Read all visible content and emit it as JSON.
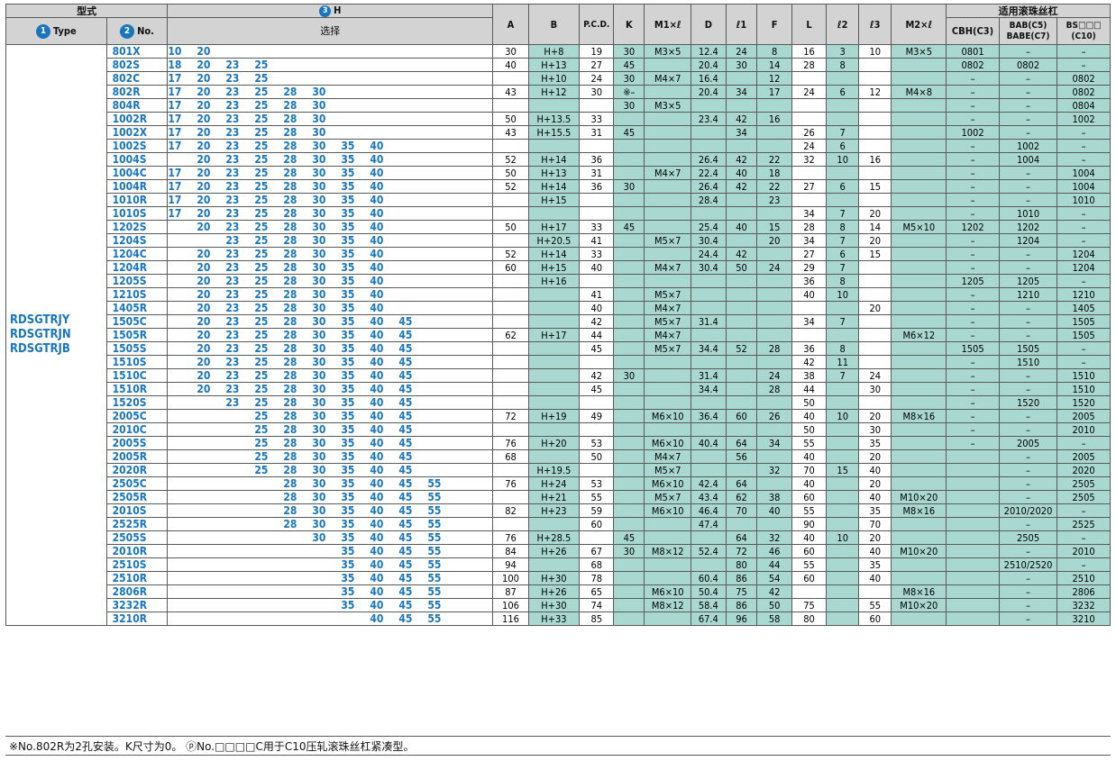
{
  "header": {
    "type_group": "型式",
    "type_label": "Type",
    "no_label": "No.",
    "h_label": "H",
    "h_sub": "选择",
    "badge1": "1",
    "badge2": "2",
    "badge3": "3",
    "cols": [
      "A",
      "B",
      "P.C.D.",
      "K",
      "M1×ℓ",
      "D",
      "ℓ1",
      "F",
      "L",
      "ℓ2",
      "ℓ3",
      "M2×ℓ"
    ],
    "screw_group": "适用滚珠丝杠",
    "cbh": "CBH(C3)",
    "bab": "BAB(C5) BABE(C7)",
    "bs": "BS□□□ (C10)"
  },
  "types": [
    "RDSGTRJY",
    "RDSGTRJN",
    "RDSGTRJB"
  ],
  "rows": [
    {
      "no": "801X",
      "h": [
        "10",
        "20",
        "",
        "",
        "",
        "",
        "",
        "",
        ""
      ]
    },
    {
      "no": "802S",
      "h": [
        "18",
        "20",
        "23",
        "25",
        "",
        "",
        "",
        "",
        ""
      ]
    },
    {
      "no": "802C",
      "h": [
        "17",
        "20",
        "23",
        "25",
        "",
        "",
        "",
        "",
        ""
      ]
    },
    {
      "no": "802R",
      "h": [
        "17",
        "20",
        "23",
        "25",
        "28",
        "30",
        "",
        "",
        ""
      ]
    },
    {
      "no": "804R",
      "h": [
        "17",
        "20",
        "23",
        "25",
        "28",
        "30",
        "",
        "",
        ""
      ]
    },
    {
      "no": "1002R",
      "h": [
        "17",
        "20",
        "23",
        "25",
        "28",
        "30",
        "",
        "",
        ""
      ]
    },
    {
      "no": "1002X",
      "h": [
        "17",
        "20",
        "23",
        "25",
        "28",
        "30",
        "",
        "",
        ""
      ]
    },
    {
      "no": "1002S",
      "h": [
        "17",
        "20",
        "23",
        "25",
        "28",
        "30",
        "35",
        "40",
        ""
      ]
    },
    {
      "no": "1004S",
      "h": [
        "",
        "20",
        "23",
        "25",
        "28",
        "30",
        "35",
        "40",
        ""
      ]
    },
    {
      "no": "1004C",
      "h": [
        "17",
        "20",
        "23",
        "25",
        "28",
        "30",
        "35",
        "40",
        ""
      ]
    },
    {
      "no": "1004R",
      "h": [
        "17",
        "20",
        "23",
        "25",
        "28",
        "30",
        "35",
        "40",
        ""
      ]
    },
    {
      "no": "1010R",
      "h": [
        "17",
        "20",
        "23",
        "25",
        "28",
        "30",
        "35",
        "40",
        ""
      ]
    },
    {
      "no": "1010S",
      "h": [
        "17",
        "20",
        "23",
        "25",
        "28",
        "30",
        "35",
        "40",
        ""
      ]
    },
    {
      "no": "1202S",
      "h": [
        "",
        "20",
        "23",
        "25",
        "28",
        "30",
        "35",
        "40",
        ""
      ]
    },
    {
      "no": "1204S",
      "h": [
        "",
        "",
        "23",
        "25",
        "28",
        "30",
        "35",
        "40",
        ""
      ]
    },
    {
      "no": "1204C",
      "h": [
        "",
        "20",
        "23",
        "25",
        "28",
        "30",
        "35",
        "40",
        ""
      ]
    },
    {
      "no": "1204R",
      "h": [
        "",
        "20",
        "23",
        "25",
        "28",
        "30",
        "35",
        "40",
        ""
      ]
    },
    {
      "no": "1205S",
      "h": [
        "",
        "20",
        "23",
        "25",
        "28",
        "30",
        "35",
        "40",
        ""
      ]
    },
    {
      "no": "1210S",
      "h": [
        "",
        "20",
        "23",
        "25",
        "28",
        "30",
        "35",
        "40",
        ""
      ]
    },
    {
      "no": "1405R",
      "h": [
        "",
        "20",
        "23",
        "25",
        "28",
        "30",
        "35",
        "40",
        ""
      ]
    },
    {
      "no": "1505C",
      "h": [
        "",
        "20",
        "23",
        "25",
        "28",
        "30",
        "35",
        "40",
        "45"
      ]
    },
    {
      "no": "1505R",
      "h": [
        "",
        "20",
        "23",
        "25",
        "28",
        "30",
        "35",
        "40",
        "45"
      ]
    },
    {
      "no": "1505S",
      "h": [
        "",
        "20",
        "23",
        "25",
        "28",
        "30",
        "35",
        "40",
        "45"
      ]
    },
    {
      "no": "1510S",
      "h": [
        "",
        "20",
        "23",
        "25",
        "28",
        "30",
        "35",
        "40",
        "45"
      ]
    },
    {
      "no": "1510C",
      "h": [
        "",
        "20",
        "23",
        "25",
        "28",
        "30",
        "35",
        "40",
        "45"
      ]
    },
    {
      "no": "1510R",
      "h": [
        "",
        "20",
        "23",
        "25",
        "28",
        "30",
        "35",
        "40",
        "45"
      ]
    },
    {
      "no": "1520S",
      "h": [
        "",
        "",
        "23",
        "25",
        "28",
        "30",
        "35",
        "40",
        "45"
      ]
    },
    {
      "no": "2005C",
      "h": [
        "",
        "",
        "",
        "25",
        "28",
        "30",
        "35",
        "40",
        "45"
      ]
    },
    {
      "no": "2010C",
      "h": [
        "",
        "",
        "",
        "25",
        "28",
        "30",
        "35",
        "40",
        "45"
      ]
    },
    {
      "no": "2005S",
      "h": [
        "",
        "",
        "",
        "25",
        "28",
        "30",
        "35",
        "40",
        "45"
      ]
    },
    {
      "no": "2005R",
      "h": [
        "",
        "",
        "",
        "25",
        "28",
        "30",
        "35",
        "40",
        "45"
      ]
    },
    {
      "no": "2020R",
      "h": [
        "",
        "",
        "",
        "25",
        "28",
        "30",
        "35",
        "40",
        "45"
      ]
    },
    {
      "no": "2505C",
      "h": [
        "",
        "",
        "",
        "",
        "28",
        "30",
        "35",
        "40",
        "45",
        "55"
      ]
    },
    {
      "no": "2505R",
      "h": [
        "",
        "",
        "",
        "",
        "28",
        "30",
        "35",
        "40",
        "45",
        "55"
      ]
    },
    {
      "no": "2010S",
      "h": [
        "",
        "",
        "",
        "",
        "28",
        "30",
        "35",
        "40",
        "45",
        "55"
      ]
    },
    {
      "no": "2525R",
      "h": [
        "",
        "",
        "",
        "",
        "28",
        "30",
        "35",
        "40",
        "45",
        "55"
      ]
    },
    {
      "no": "2505S",
      "h": [
        "",
        "",
        "",
        "",
        "",
        "30",
        "35",
        "40",
        "45",
        "55"
      ]
    },
    {
      "no": "2010R",
      "h": [
        "",
        "",
        "",
        "",
        "",
        "",
        "35",
        "40",
        "45",
        "55"
      ]
    },
    {
      "no": "2510S",
      "h": [
        "",
        "",
        "",
        "",
        "",
        "",
        "35",
        "40",
        "45",
        "55"
      ]
    },
    {
      "no": "2510R",
      "h": [
        "",
        "",
        "",
        "",
        "",
        "",
        "35",
        "40",
        "45",
        "55"
      ]
    },
    {
      "no": "2806R",
      "h": [
        "",
        "",
        "",
        "",
        "",
        "",
        "35",
        "40",
        "45",
        "55"
      ]
    },
    {
      "no": "3232R",
      "h": [
        "",
        "",
        "",
        "",
        "",
        "",
        "35",
        "40",
        "45",
        "55"
      ]
    },
    {
      "no": "3210R",
      "h": [
        "",
        "",
        "",
        "",
        "",
        "",
        "",
        "40",
        "45",
        "55"
      ]
    }
  ],
  "dims": [
    [
      "30",
      "H+8",
      "19",
      "30",
      "M3×5",
      "12.4",
      "24",
      "8",
      "16",
      "3",
      "10",
      "M3×5",
      "0801",
      "–",
      "–"
    ],
    [
      "40",
      "H+13",
      "27",
      "45",
      "",
      "20.4",
      "30",
      "14",
      "28",
      "8",
      "",
      "",
      "0802",
      "0802",
      "–"
    ],
    [
      "",
      "H+10",
      "24",
      "30",
      "M4×7",
      "16.4",
      "",
      "12",
      "",
      "",
      "",
      "",
      "–",
      "–",
      "0802"
    ],
    [
      "43",
      "H+12",
      "30",
      "※–",
      "",
      "20.4",
      "34",
      "17",
      "24",
      "6",
      "12",
      "M4×8",
      "–",
      "–",
      "0802"
    ],
    [
      "",
      "",
      "",
      "30",
      "M3×5",
      "",
      "",
      "",
      "",
      "",
      "",
      "",
      "–",
      "–",
      "0804"
    ],
    [
      "50",
      "H+13.5",
      "33",
      "",
      "",
      "23.4",
      "42",
      "16",
      "",
      "",
      "",
      "",
      "–",
      "–",
      "1002"
    ],
    [
      "43",
      "H+15.5",
      "31",
      "45",
      "",
      "",
      "34",
      "",
      "26",
      "7",
      "",
      "",
      "1002",
      "–",
      "–"
    ],
    [
      "",
      "",
      "",
      "",
      "",
      "",
      "",
      "",
      "24",
      "6",
      "",
      "",
      "–",
      "1002",
      "–"
    ],
    [
      "52",
      "H+14",
      "36",
      "",
      "",
      "26.4",
      "42",
      "22",
      "32",
      "10",
      "16",
      "",
      "–",
      "1004",
      "–"
    ],
    [
      "50",
      "H+13",
      "31",
      "",
      "M4×7",
      "22.4",
      "40",
      "18",
      "",
      "",
      "",
      "",
      "–",
      "–",
      "1004"
    ],
    [
      "52",
      "H+14",
      "36",
      "30",
      "",
      "26.4",
      "42",
      "22",
      "27",
      "6",
      "15",
      "",
      "–",
      "–",
      "1004"
    ],
    [
      "",
      "H+15",
      "",
      "",
      "",
      "28.4",
      "",
      "23",
      "",
      "",
      "",
      "",
      "–",
      "–",
      "1010"
    ],
    [
      "",
      "",
      "",
      "",
      "",
      "",
      "",
      "",
      "34",
      "7",
      "20",
      "",
      "–",
      "1010",
      "–"
    ],
    [
      "50",
      "H+17",
      "33",
      "45",
      "",
      "25.4",
      "40",
      "15",
      "28",
      "8",
      "14",
      "M5×10",
      "1202",
      "1202",
      "–"
    ],
    [
      "",
      "H+20.5",
      "41",
      "",
      "M5×7",
      "30.4",
      "",
      "20",
      "34",
      "7",
      "20",
      "",
      "–",
      "1204",
      "–"
    ],
    [
      "52",
      "H+14",
      "33",
      "",
      "",
      "24.4",
      "42",
      "",
      "27",
      "6",
      "15",
      "",
      "–",
      "–",
      "1204"
    ],
    [
      "60",
      "H+15",
      "40",
      "",
      "M4×7",
      "30.4",
      "50",
      "24",
      "29",
      "7",
      "",
      "",
      "–",
      "–",
      "1204"
    ],
    [
      "",
      "H+16",
      "",
      "",
      "",
      "",
      "",
      "",
      "36",
      "8",
      "",
      "",
      "1205",
      "1205",
      "–"
    ],
    [
      "",
      "",
      "41",
      "",
      "M5×7",
      "",
      "",
      "",
      "40",
      "10",
      "",
      "",
      "–",
      "1210",
      "1210"
    ],
    [
      "",
      "",
      "40",
      "",
      "M4×7",
      "",
      "",
      "",
      "",
      "",
      "20",
      "",
      "–",
      "–",
      "1405"
    ],
    [
      "",
      "",
      "42",
      "",
      "M5×7",
      "31.4",
      "",
      "",
      "34",
      "7",
      "",
      "",
      "–",
      "–",
      "1505"
    ],
    [
      "62",
      "H+17",
      "44",
      "",
      "M4×7",
      "",
      "",
      "",
      "",
      "",
      "",
      "M6×12",
      "–",
      "–",
      "1505"
    ],
    [
      "",
      "",
      "45",
      "",
      "M5×7",
      "34.4",
      "52",
      "28",
      "36",
      "8",
      "",
      "",
      "1505",
      "1505",
      "–"
    ],
    [
      "",
      "",
      "",
      "",
      "",
      "",
      "",
      "",
      "42",
      "11",
      "",
      "",
      "–",
      "1510",
      "–"
    ],
    [
      "",
      "",
      "42",
      "30",
      "",
      "31.4",
      "",
      "24",
      "38",
      "7",
      "24",
      "",
      "–",
      "–",
      "1510"
    ],
    [
      "",
      "",
      "45",
      "",
      "",
      "34.4",
      "",
      "28",
      "44",
      "",
      "30",
      "",
      "–",
      "–",
      "1510"
    ],
    [
      "",
      "",
      "",
      "",
      "",
      "",
      "",
      "",
      "50",
      "",
      "",
      "",
      "–",
      "1520",
      "1520"
    ],
    [
      "72",
      "H+19",
      "49",
      "",
      "M6×10",
      "36.4",
      "60",
      "26",
      "40",
      "10",
      "20",
      "M8×16",
      "–",
      "–",
      "2005"
    ],
    [
      "",
      "",
      "",
      "",
      "",
      "",
      "",
      "",
      "50",
      "",
      "30",
      "",
      "–",
      "–",
      "2010"
    ],
    [
      "76",
      "H+20",
      "53",
      "",
      "M6×10",
      "40.4",
      "64",
      "34",
      "55",
      "",
      "35",
      "",
      "–",
      "2005",
      "–"
    ],
    [
      "68",
      "",
      "50",
      "",
      "M4×7",
      "",
      "56",
      "",
      "40",
      "",
      "20",
      "",
      "",
      "–",
      "2005"
    ],
    [
      "",
      "H+19.5",
      "",
      "",
      "M5×7",
      "",
      "",
      "32",
      "70",
      "15",
      "40",
      "",
      "",
      "–",
      "2020"
    ],
    [
      "76",
      "H+24",
      "53",
      "",
      "M6×10",
      "42.4",
      "64",
      "",
      "40",
      "",
      "20",
      "",
      "",
      "–",
      "2505"
    ],
    [
      "",
      "H+21",
      "55",
      "",
      "M5×7",
      "43.4",
      "62",
      "38",
      "60",
      "",
      "40",
      "M10×20",
      "",
      "–",
      "2505"
    ],
    [
      "82",
      "H+23",
      "59",
      "",
      "M6×10",
      "46.4",
      "70",
      "40",
      "55",
      "",
      "35",
      "M8×16",
      "",
      "2010/2020",
      "–"
    ],
    [
      "",
      "",
      "60",
      "",
      "",
      "47.4",
      "",
      "",
      "90",
      "",
      "70",
      "",
      "",
      "–",
      "2525"
    ],
    [
      "76",
      "H+28.5",
      "",
      "45",
      "",
      "",
      "64",
      "32",
      "40",
      "10",
      "20",
      "",
      "",
      "2505",
      "–"
    ],
    [
      "84",
      "H+26",
      "67",
      "30",
      "M8×12",
      "52.4",
      "72",
      "46",
      "60",
      "",
      "40",
      "M10×20",
      "",
      "–",
      "2010"
    ],
    [
      "94",
      "",
      "68",
      "",
      "",
      "",
      "80",
      "44",
      "55",
      "",
      "35",
      "",
      "",
      "2510/2520",
      "–"
    ],
    [
      "100",
      "H+30",
      "78",
      "",
      "",
      "60.4",
      "86",
      "54",
      "60",
      "",
      "40",
      "",
      "",
      "–",
      "2510"
    ],
    [
      "87",
      "H+26",
      "65",
      "",
      "M6×10",
      "50.4",
      "75",
      "42",
      "",
      "",
      "",
      "M8×16",
      "",
      "–",
      "2806"
    ],
    [
      "106",
      "H+30",
      "74",
      "",
      "M8×12",
      "58.4",
      "86",
      "50",
      "75",
      "",
      "55",
      "M10×20",
      "",
      "–",
      "3232"
    ],
    [
      "116",
      "H+33",
      "85",
      "",
      "",
      "67.4",
      "96",
      "58",
      "80",
      "",
      "60",
      "",
      "",
      "–",
      "3210"
    ]
  ],
  "footnote": "※No.802R为2孔安装。K尺寸为0。 ⓟNo.□□□□C用于C10压轧滚珠丝杠紧凑型。"
}
